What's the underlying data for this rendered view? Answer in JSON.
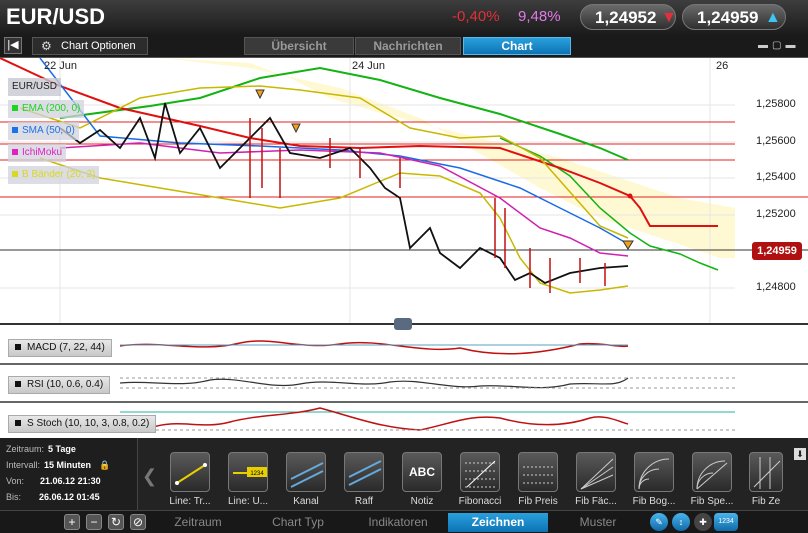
{
  "header": {
    "pair": "EUR/USD",
    "change_pct": "-0,40%",
    "volatility_pct": "9,48%",
    "bid": "1,24952",
    "ask": "1,24959"
  },
  "tabs": {
    "chart_options": "Chart Optionen",
    "items": [
      "Übersicht",
      "Nachrichten",
      "Chart"
    ],
    "active": "Chart"
  },
  "chart": {
    "x_labels": [
      "22 Jun",
      "24 Jun",
      "26"
    ],
    "y_labels": [
      "1,25800",
      "1,25600",
      "1,25400",
      "1,25200",
      "1,24800"
    ],
    "current_price": "1,24959",
    "legend": [
      {
        "label": "EUR/USD",
        "color": "#222222"
      },
      {
        "label": "EMA (200, 0)",
        "color": "#1ed41e"
      },
      {
        "label": "SMA (50, 0)",
        "color": "#1a73e8"
      },
      {
        "label": "IchiMoku",
        "color": "#e020c0"
      },
      {
        "label": "B Bänder (20, 2)",
        "color": "#d8d820"
      }
    ],
    "subcharts": [
      "MACD (7, 22, 44)",
      "RSI (10, 0.6, 0.4)",
      "S Stoch (10, 10, 3, 0.8, 0.2)"
    ]
  },
  "footer": {
    "info": [
      {
        "label": "Zeitraum:",
        "value": "5 Tage"
      },
      {
        "label": "Intervall:",
        "value": "15 Minuten"
      },
      {
        "label": "Von:",
        "value": "21.06.12 21:30"
      },
      {
        "label": "Bis:",
        "value": "26.06.12 01:45"
      }
    ],
    "tools": [
      "Line: Tr...",
      "Line: U...",
      "Kanal",
      "Raff",
      "Notiz",
      "Fibonacci",
      "Fib Preis",
      "Fib Fäc...",
      "Fib Bog...",
      "Fib Spe...",
      "Fib Ze"
    ],
    "notiz_icon_text": "ABC",
    "line_icon_text": "1234",
    "bottom_tabs": [
      "Zeitraum",
      "Chart Typ",
      "Indikatoren",
      "Zeichnen",
      "Muster"
    ],
    "active_bottom_tab": "Zeichnen",
    "counter_badge": "1234"
  }
}
